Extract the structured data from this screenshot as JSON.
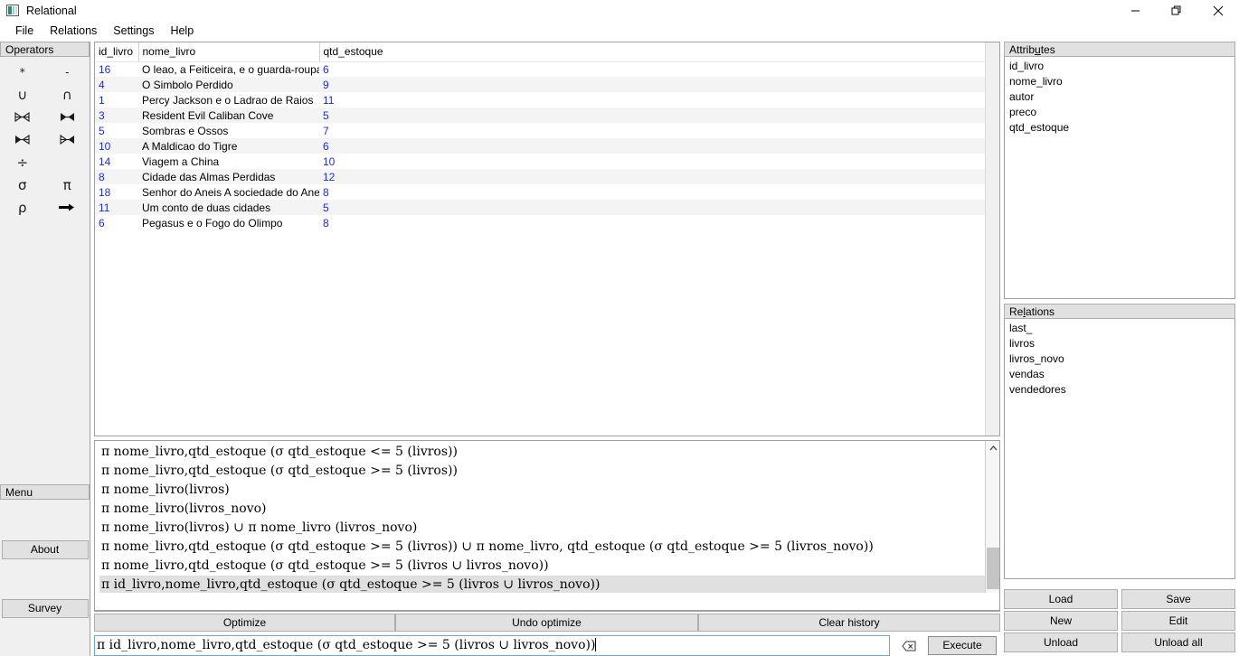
{
  "window": {
    "title": "Relational",
    "icon": "app-icon",
    "controls": {
      "minimize": "minimize-icon",
      "maximize": "maximize-icon",
      "close": "close-icon"
    }
  },
  "menubar": {
    "items": [
      "File",
      "Relations",
      "Settings",
      "Help"
    ]
  },
  "operators": {
    "header": "Operators",
    "items": [
      {
        "glyph": "*",
        "name": "product-operator",
        "small": true
      },
      {
        "glyph": "-",
        "name": "difference-operator",
        "small": true
      },
      {
        "glyph": "∪",
        "name": "union-operator",
        "small": false
      },
      {
        "glyph": "∩",
        "name": "intersection-operator",
        "small": false
      },
      {
        "glyph": "⋈",
        "name": "natural-join-operator",
        "small": false
      },
      {
        "glyph": "⋈",
        "name": "outer-join-operator",
        "small": false
      },
      {
        "glyph": "⋈",
        "name": "left-outer-join-operator",
        "small": false
      },
      {
        "glyph": "⋈",
        "name": "right-outer-join-operator",
        "small": false
      },
      {
        "glyph": "÷",
        "name": "division-operator",
        "small": false
      },
      {
        "glyph": "",
        "name": "empty-operator-slot",
        "small": false
      },
      {
        "glyph": "σ",
        "name": "selection-operator",
        "small": false
      },
      {
        "glyph": "π",
        "name": "projection-operator",
        "small": false
      },
      {
        "glyph": "ρ",
        "name": "rename-operator",
        "small": false
      },
      {
        "glyph": "➡",
        "name": "assignment-arrow-operator",
        "small": false
      }
    ]
  },
  "menu_panel": {
    "header": "Menu",
    "about_label": "About",
    "survey_label": "Survey"
  },
  "table": {
    "columns": [
      "id_livro",
      "nome_livro",
      "qtd_estoque"
    ],
    "rows": [
      [
        "16",
        "O leao, a Feiticeira, e o guarda-roupa",
        "6"
      ],
      [
        "4",
        "O Simbolo Perdido",
        "9"
      ],
      [
        "1",
        "Percy Jackson e o Ladrao de Raios",
        "11"
      ],
      [
        "3",
        "Resident Evil Caliban Cove",
        "5"
      ],
      [
        "5",
        "Sombras e Ossos",
        "7"
      ],
      [
        "10",
        "A Maldicao do Tigre",
        "6"
      ],
      [
        "14",
        "Viagem a China",
        "10"
      ],
      [
        "8",
        "Cidade das Almas Perdidas",
        "12"
      ],
      [
        "18",
        "Senhor do Aneis A sociedade do Anel",
        "8"
      ],
      [
        "11",
        "Um conto de duas cidades",
        "5"
      ],
      [
        "6",
        "Pegasus e o Fogo do Olimpo",
        "8"
      ]
    ]
  },
  "attributes": {
    "header_pre": "Attrib",
    "header_mnemonic": "u",
    "header_post": "tes",
    "items": [
      "id_livro",
      "nome_livro",
      "autor",
      "preco",
      "qtd_estoque"
    ]
  },
  "relations": {
    "header_pre": "Re",
    "header_mnemonic": "l",
    "header_post": "ations",
    "items": [
      "last_",
      "livros",
      "livros_novo",
      "vendas",
      "vendedores"
    ]
  },
  "right_buttons": [
    "Load",
    "Save",
    "New",
    "Edit",
    "Unload",
    "Unload all"
  ],
  "history": {
    "entries": [
      {
        "text": "π nome_livro,qtd_estoque (σ qtd_estoque <= 5 (livros))",
        "selected": false
      },
      {
        "text": "π nome_livro,qtd_estoque (σ qtd_estoque >= 5 (livros))",
        "selected": false
      },
      {
        "text": "π nome_livro(livros)",
        "selected": false
      },
      {
        "text": "π nome_livro(livros_novo)",
        "selected": false
      },
      {
        "text": "π nome_livro(livros) ∪ π nome_livro (livros_novo)",
        "selected": false
      },
      {
        "text": "π nome_livro,qtd_estoque (σ qtd_estoque >= 5 (livros)) ∪ π nome_livro, qtd_estoque (σ qtd_estoque >= 5 (livros_novo))",
        "selected": false
      },
      {
        "text": "π nome_livro,qtd_estoque (σ qtd_estoque >= 5 (livros ∪ livros_novo))",
        "selected": false
      },
      {
        "text": "π id_livro,nome_livro,qtd_estoque (σ qtd_estoque >= 5 (livros ∪ livros_novo))",
        "selected": true
      }
    ],
    "scroll_up_icon": "chevron-up-icon",
    "scroll_down_icon": "chevron-down-icon"
  },
  "action_bar": {
    "optimize": "Optimize",
    "undo_optimize": "Undo optimize",
    "clear_history": "Clear history"
  },
  "query": {
    "value": "π id_livro,nome_livro,qtd_estoque (σ qtd_estoque >= 5 (livros ∪ livros_novo))",
    "clear_icon": "backspace-clear-icon",
    "execute_label": "Execute"
  },
  "colors": {
    "number_text": "#1f2fc0",
    "panel_bg": "#f0f0f0",
    "header_bg": "#e1e1e1",
    "selection_bg": "#e0e0e0",
    "input_border": "#6aa7d8"
  }
}
